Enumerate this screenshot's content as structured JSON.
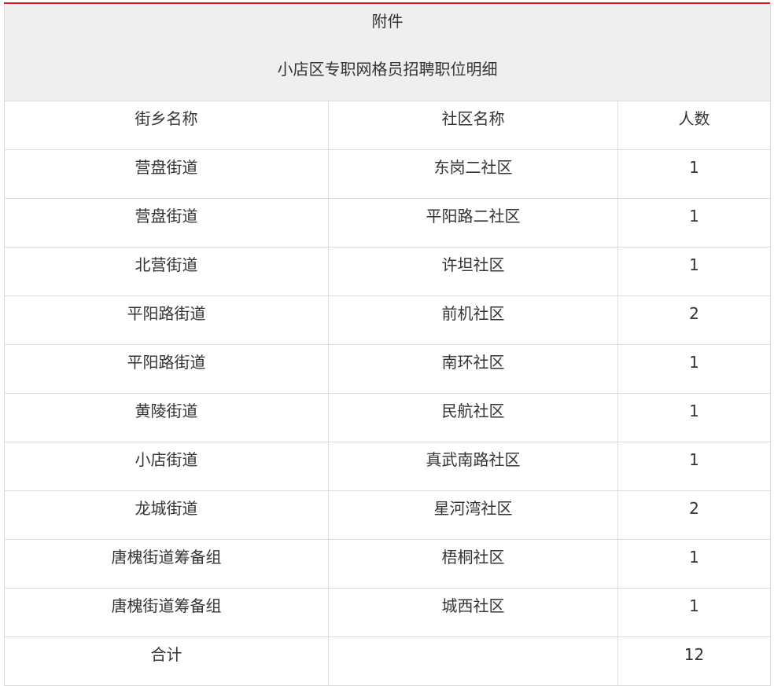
{
  "document": {
    "attachment_label": "附件",
    "title": "小店区专职网格员招聘职位明细"
  },
  "table": {
    "headers": [
      "街乡名称",
      "社区名称",
      "人数"
    ],
    "rows": [
      [
        "营盘街道",
        "东岗二社区",
        "1"
      ],
      [
        "营盘街道",
        "平阳路二社区",
        "1"
      ],
      [
        "北营街道",
        "许坦社区",
        "1"
      ],
      [
        "平阳路街道",
        "前机社区",
        "2"
      ],
      [
        "平阳路街道",
        "南环社区",
        "1"
      ],
      [
        "黄陵街道",
        "民航社区",
        "1"
      ],
      [
        "小店街道",
        "真武南路社区",
        "1"
      ],
      [
        "龙城街道",
        "星河湾社区",
        "2"
      ],
      [
        "唐槐街道筹备组",
        "梧桐社区",
        "1"
      ],
      [
        "唐槐街道筹备组",
        "城西社区",
        "1"
      ]
    ],
    "total": [
      "合计",
      "",
      "12"
    ]
  },
  "colors": {
    "accent_rule": "#d7191f",
    "header_bg": "#efefef",
    "border": "#dcdcdc",
    "text": "#333333"
  }
}
